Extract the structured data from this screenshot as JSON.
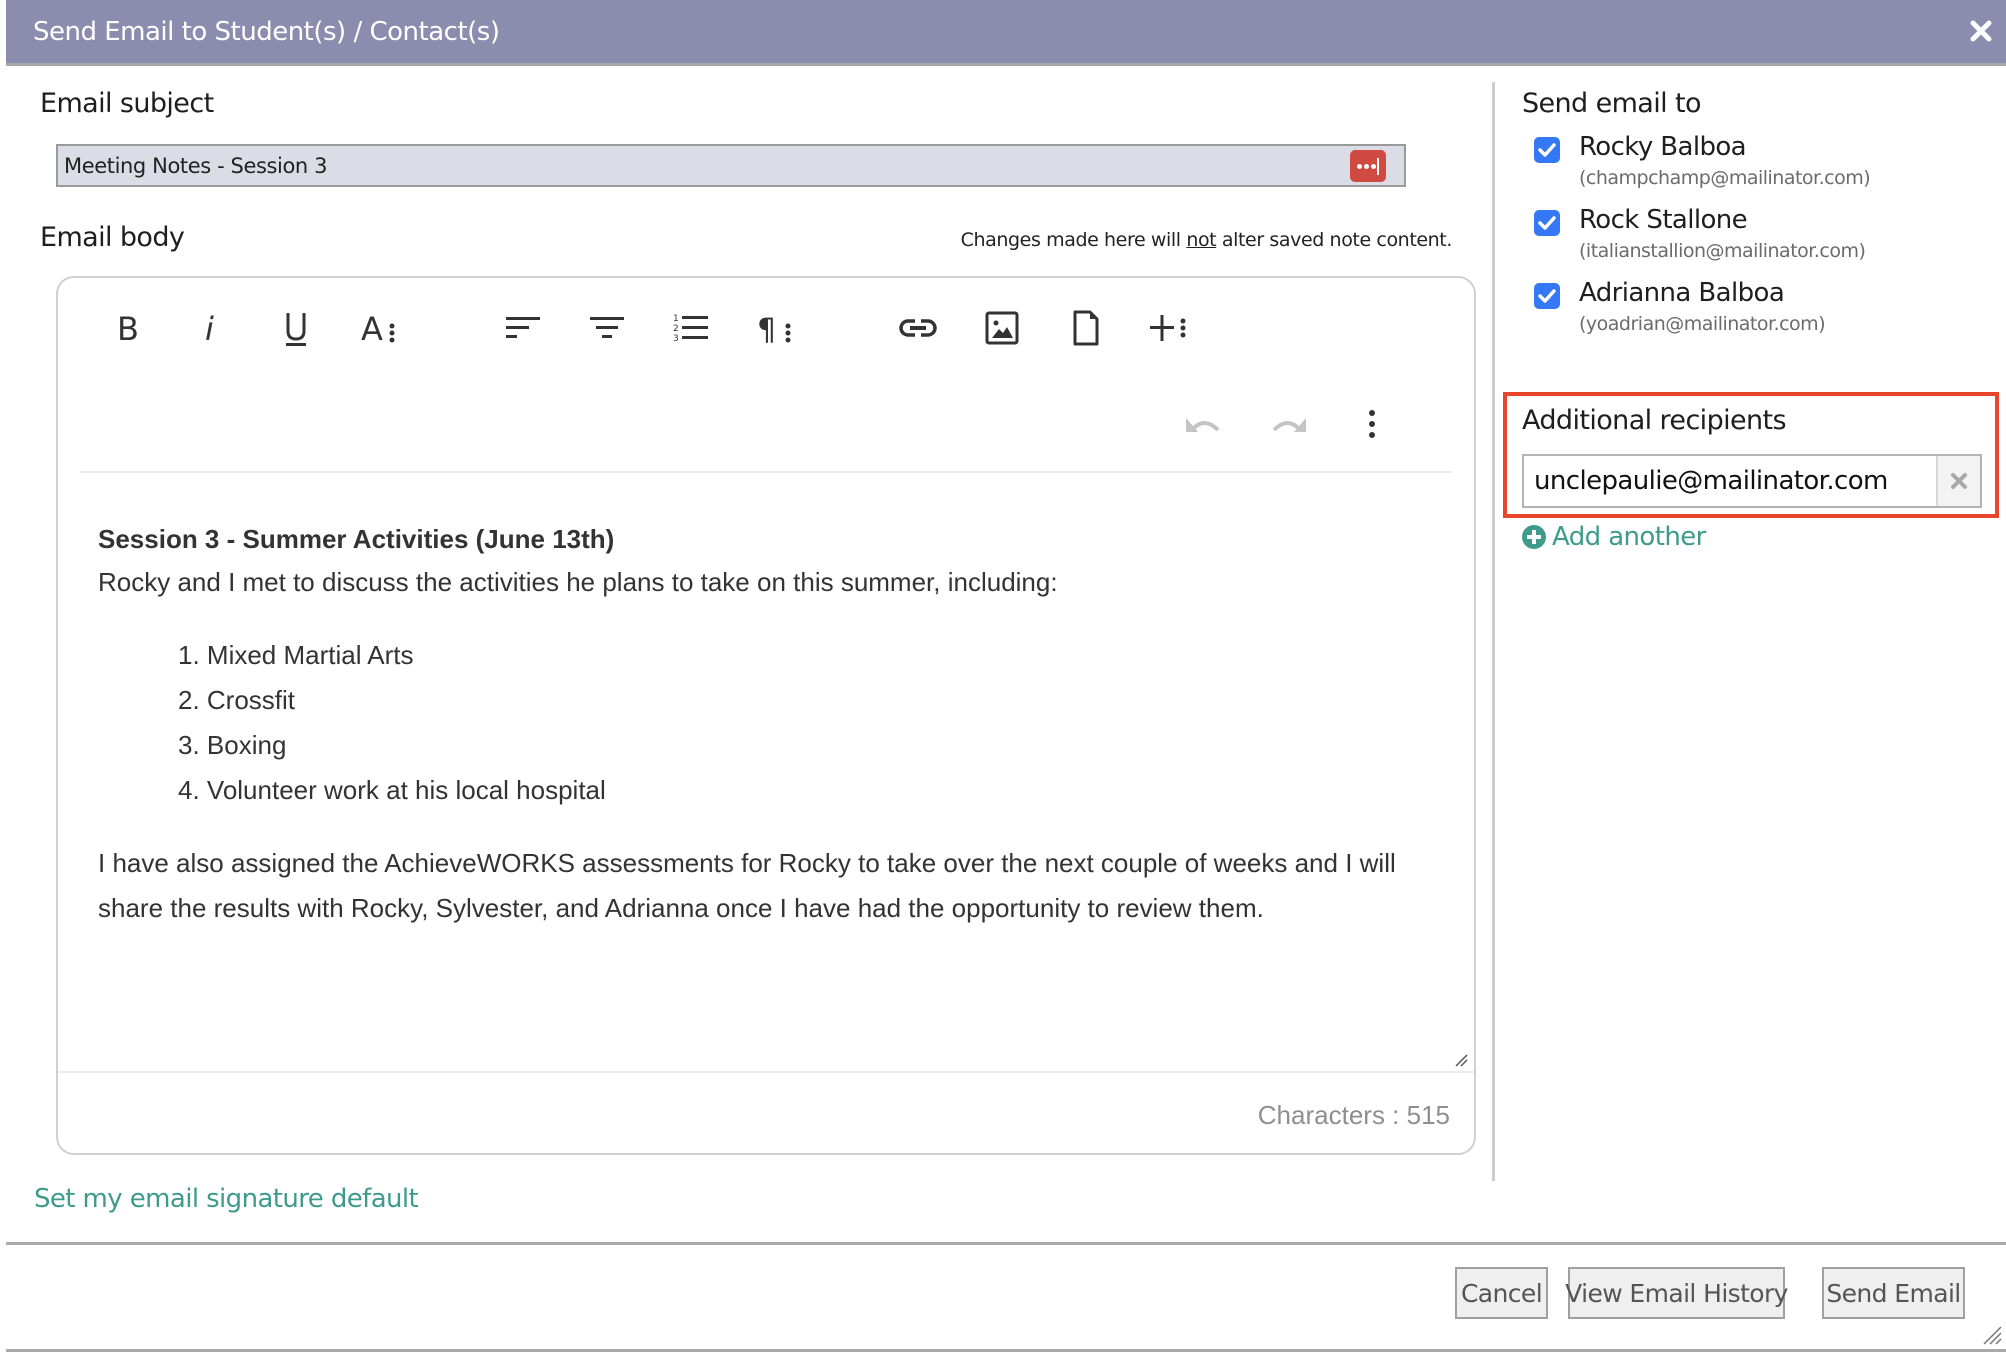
{
  "dialog": {
    "title": "Send Email to Student(s) / Contact(s)",
    "close_icon": "close-icon"
  },
  "subject": {
    "label": "Email subject",
    "value": "Meeting Notes - Session 3",
    "password_manager_icon": "password-manager-icon"
  },
  "body": {
    "label": "Email body",
    "hint_prefix": "Changes made here will ",
    "hint_emphasis": "not",
    "hint_suffix": " alter saved note content.",
    "toolbar": [
      {
        "name": "bold",
        "icon": "bold-icon"
      },
      {
        "name": "italic",
        "icon": "italic-icon"
      },
      {
        "name": "underline",
        "icon": "underline-icon"
      },
      {
        "name": "text-more",
        "icon": "text-more-icon"
      },
      {
        "name": "align-left",
        "icon": "align-left-icon"
      },
      {
        "name": "align-center",
        "icon": "align-center-icon"
      },
      {
        "name": "ordered-list",
        "icon": "ordered-list-icon"
      },
      {
        "name": "paragraph-more",
        "icon": "paragraph-more-icon"
      },
      {
        "name": "insert-link",
        "icon": "link-icon"
      },
      {
        "name": "insert-image",
        "icon": "image-icon"
      },
      {
        "name": "insert-file",
        "icon": "file-icon"
      },
      {
        "name": "insert-more",
        "icon": "insert-more-icon"
      },
      {
        "name": "undo",
        "icon": "undo-icon"
      },
      {
        "name": "redo",
        "icon": "redo-icon"
      },
      {
        "name": "more-options",
        "icon": "more-vertical-icon"
      }
    ],
    "content": {
      "heading": "Session 3 - Summer Activities (June 13th)",
      "intro": "Rocky and I met to discuss the activities he plans to take on this summer, including:",
      "list": [
        "1. Mixed Martial Arts",
        "2. Crossfit",
        "3. Boxing",
        "4. Volunteer work at his local hospital"
      ],
      "closing": "I have also assigned the AchieveWORKS assessments for Rocky to take over the next couple of weeks and I will share the results with Rocky, Sylvester, and Adrianna once I have had the opportunity to review them."
    },
    "char_count": "Characters : 515"
  },
  "signature_link": "Set my email signature default",
  "send_to": {
    "label": "Send email to",
    "recipients": [
      {
        "name": "Rocky Balboa",
        "email": "(champchamp@mailinator.com)",
        "checked": true
      },
      {
        "name": "Rock Stallone",
        "email": "(italianstallion@mailinator.com)",
        "checked": true
      },
      {
        "name": "Adrianna Balboa",
        "email": "(yoadrian@mailinator.com)",
        "checked": true
      }
    ]
  },
  "additional": {
    "label": "Additional recipients",
    "value": "unclepaulie@mailinator.com",
    "add_another": "Add another"
  },
  "buttons": {
    "cancel": "Cancel",
    "history": "View Email History",
    "send": "Send Email"
  },
  "colors": {
    "header": "#8b8cae",
    "accent": "#3e9b8c",
    "checkbox": "#3478f6",
    "highlight": "#e8452c",
    "password_icon": "#cf4a40"
  }
}
